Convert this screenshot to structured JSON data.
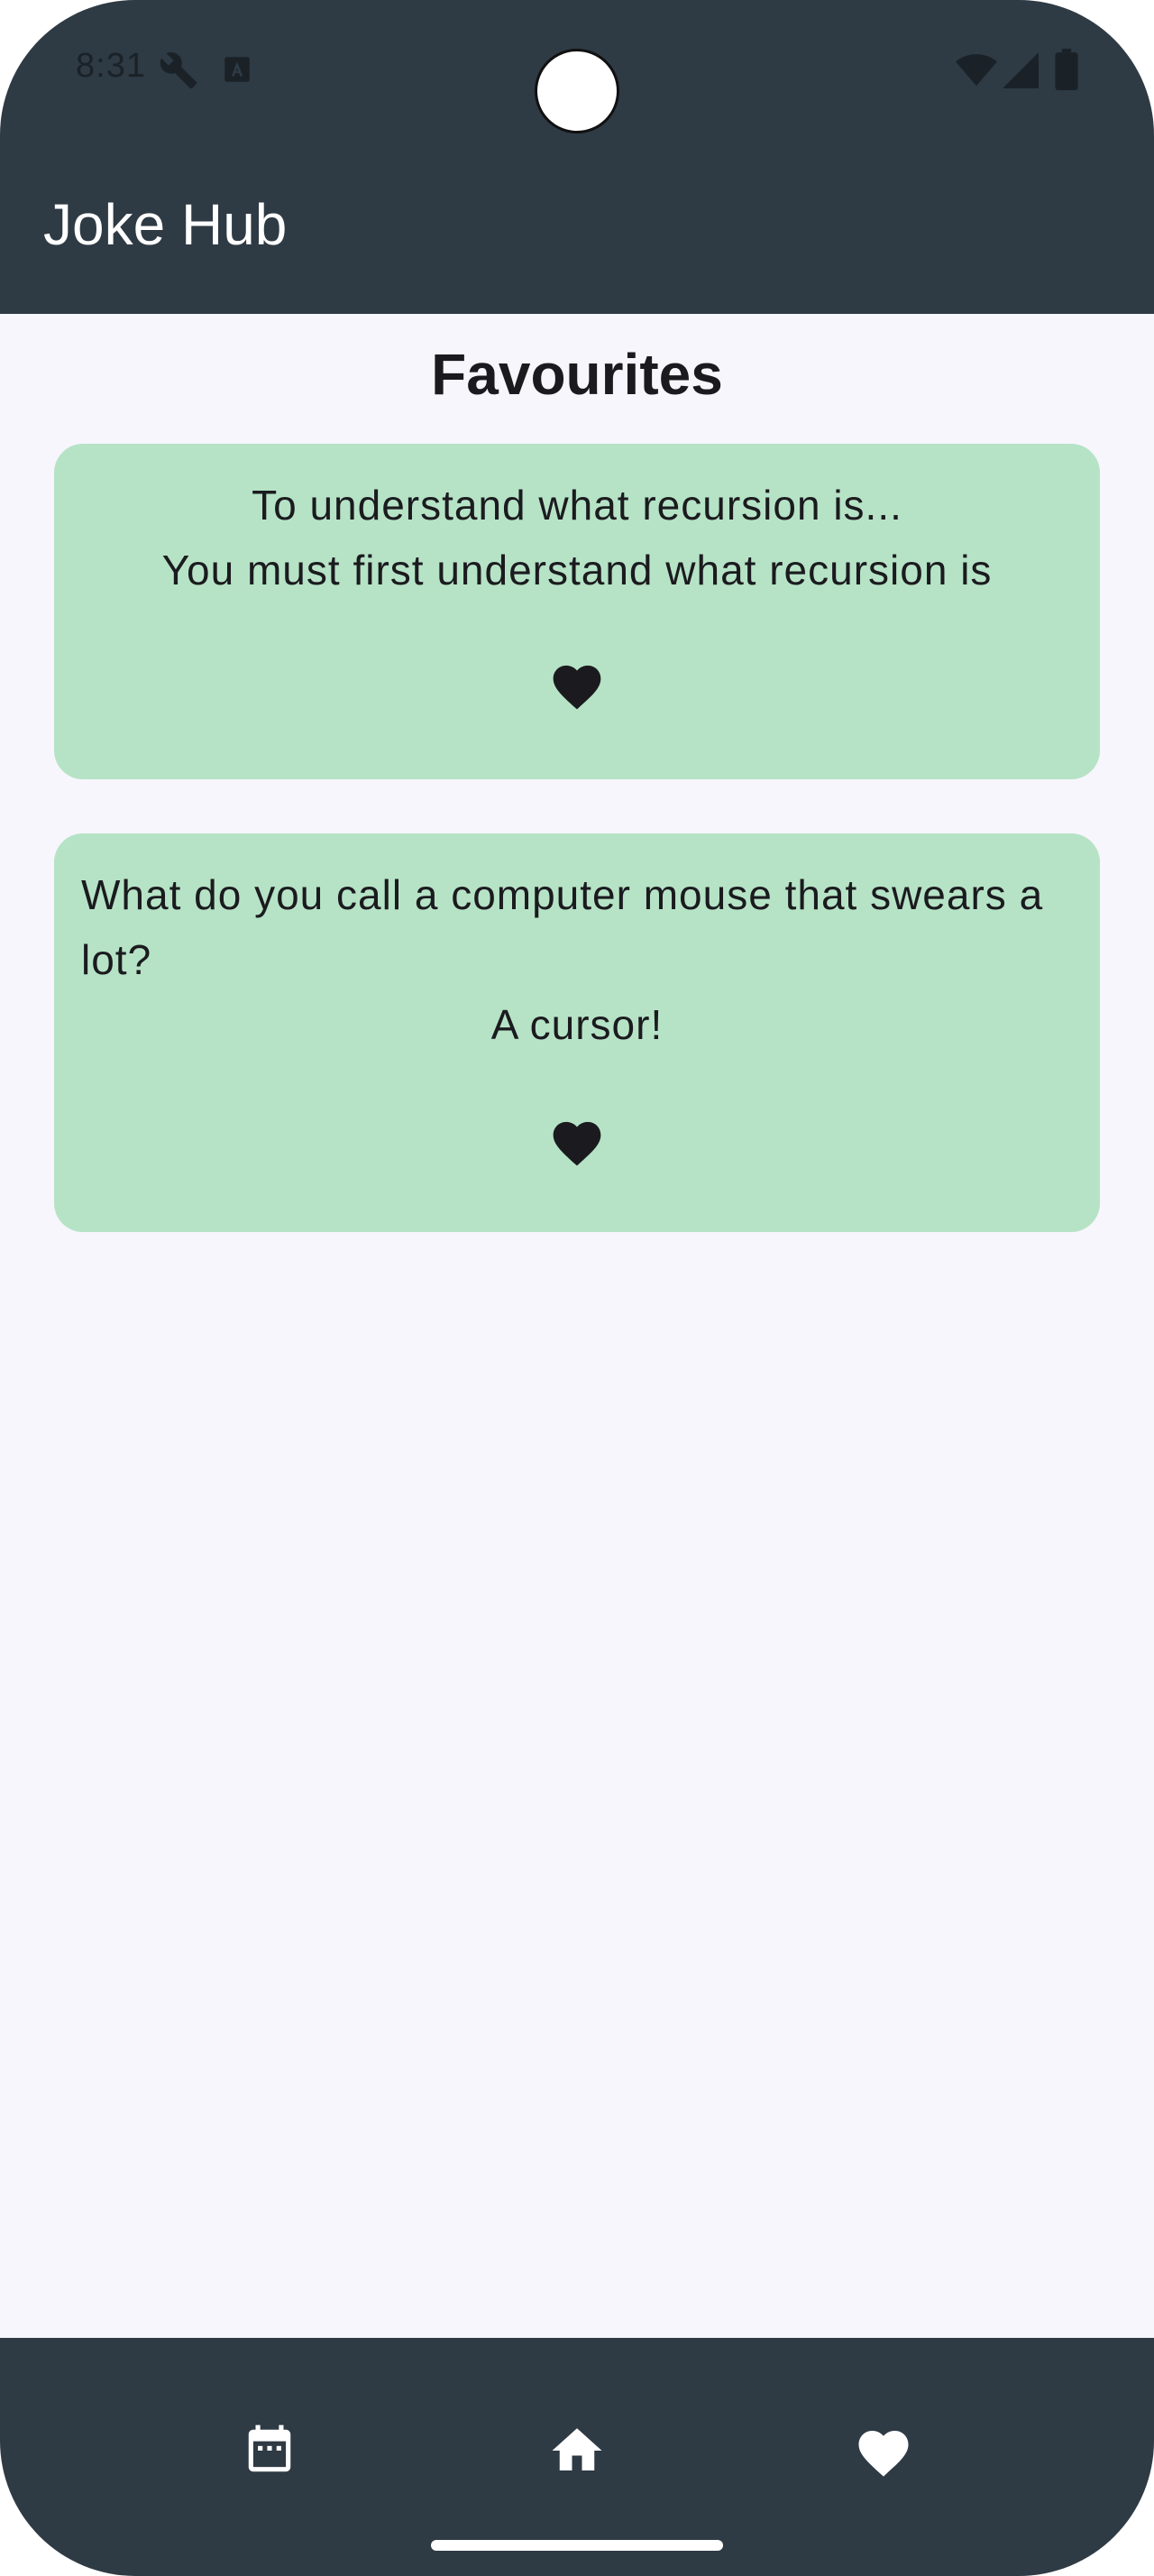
{
  "status_bar": {
    "time": "8:31",
    "icons": [
      "wrench-icon",
      "text-a-icon",
      "wifi-icon",
      "signal-icon",
      "battery-icon"
    ]
  },
  "app_bar": {
    "title": "Joke Hub"
  },
  "favourites": {
    "title": "Favourites",
    "jokes": [
      {
        "setup": "To understand what recursion is...",
        "punchline": "You must first understand what recursion is",
        "favourited": true
      },
      {
        "setup": "What do you call a computer mouse that swears a lot?",
        "punchline": "A cursor!",
        "favourited": true
      }
    ]
  },
  "bottom_nav": {
    "items": [
      {
        "icon": "calendar-icon"
      },
      {
        "icon": "home-icon"
      },
      {
        "icon": "heart-icon"
      }
    ]
  },
  "colors": {
    "bar": "#2e3a44",
    "card": "#b6e3c6",
    "background": "#f7f6fc",
    "heart": "#1b1b1f"
  }
}
